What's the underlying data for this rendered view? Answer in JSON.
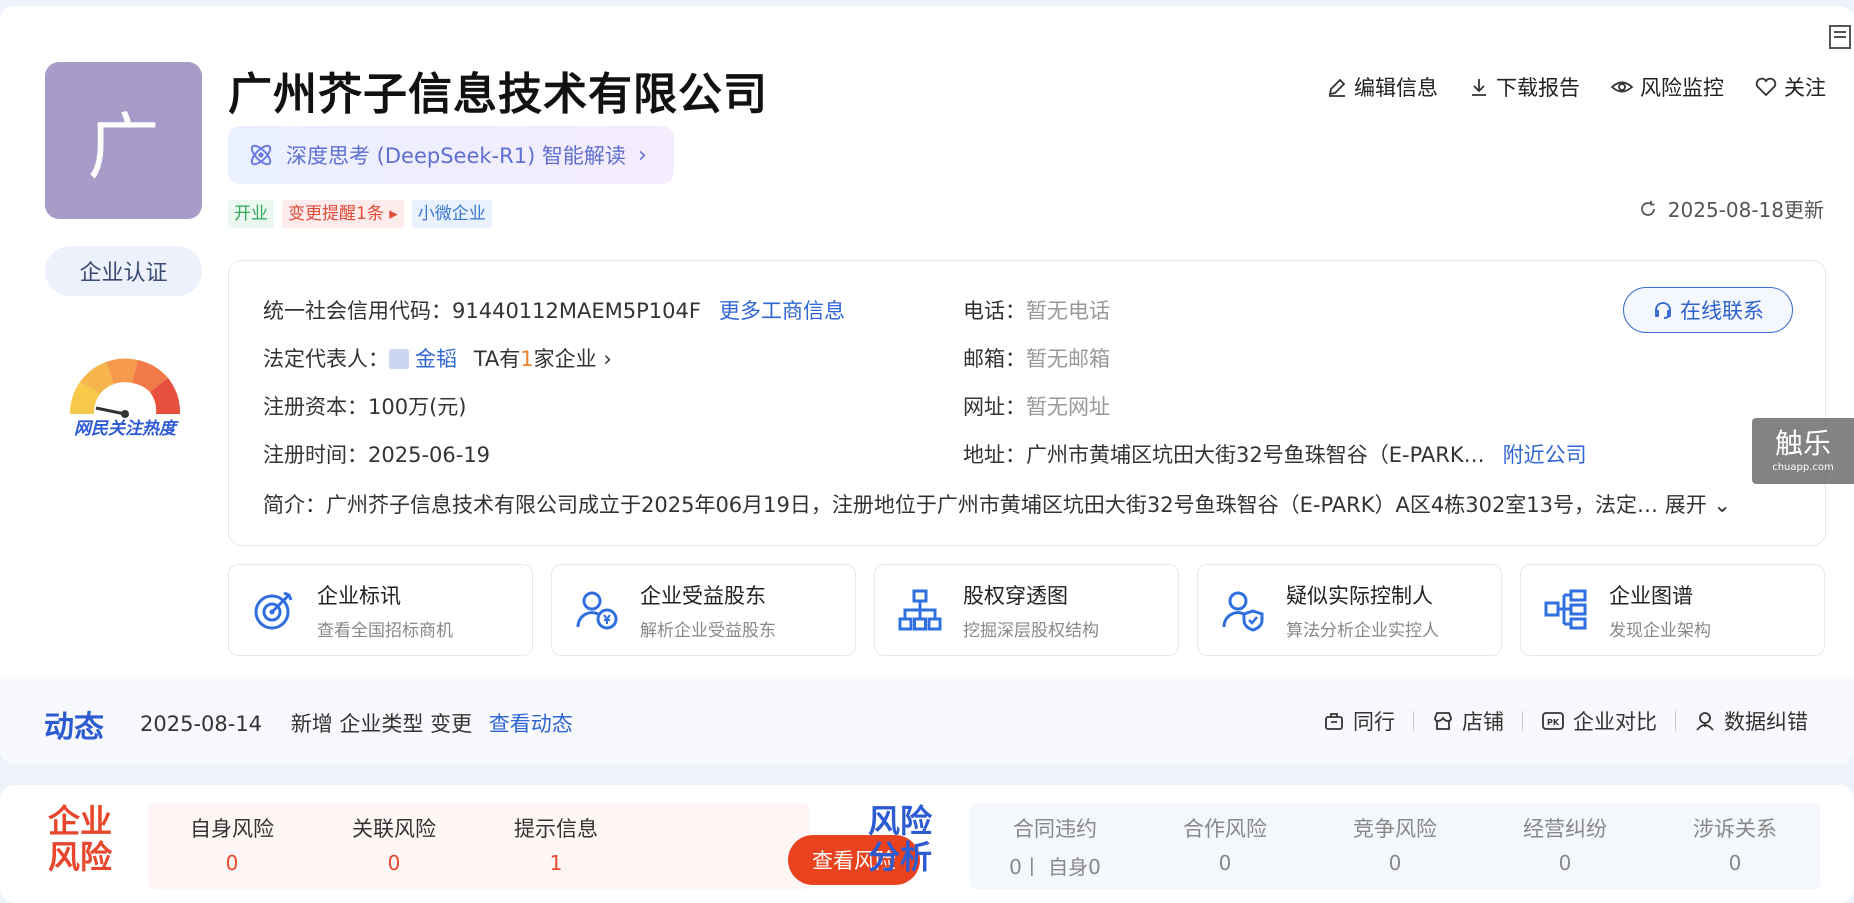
{
  "company": {
    "avatar_char": "广",
    "name": "广州芥子信息技术有限公司",
    "cert_label": "企业认证",
    "heat_label": "网民关注热度"
  },
  "deepseek": {
    "label": "深度思考 (DeepSeek-R1) 智能解读",
    "arrow": "›"
  },
  "tags": {
    "status": "开业",
    "change": "变更提醒1条",
    "change_arrow": "▸",
    "size": "小微企业"
  },
  "top_actions": {
    "edit": "编辑信息",
    "download": "下载报告",
    "monitor": "风险监控",
    "follow": "关注"
  },
  "updated": "2025-08-18更新",
  "info": {
    "credit_label": "统一社会信用代码：",
    "credit_value": "91440112MAEM5P104F",
    "more_link": "更多工商信息",
    "legal_label": "法定代表人：",
    "legal_name": "金韬",
    "legal_extra_pre": "TA有",
    "legal_extra_num": "1",
    "legal_extra_post": "家企业",
    "legal_arrow": "›",
    "capital_label": "注册资本：",
    "capital_value": "100万(元)",
    "date_label": "注册时间：",
    "date_value": "2025-06-19",
    "phone_label": "电话：",
    "phone_value": "暂无电话",
    "email_label": "邮箱：",
    "email_value": "暂无邮箱",
    "website_label": "网址：",
    "website_value": "暂无网址",
    "address_label": "地址：",
    "address_value": "广州市黄埔区坑田大街32号鱼珠智谷（E-PARK…",
    "nearby_link": "附近公司",
    "intro_label": "简介：",
    "intro_value": "广州芥子信息技术有限公司成立于2025年06月19日，注册地位于广州市黄埔区坑田大街32号鱼珠智谷（E-PARK）A区4栋302室13号，法定…",
    "expand": "展开",
    "online_contact": "在线联系"
  },
  "features": [
    {
      "title": "企业标讯",
      "sub": "查看全国招标商机"
    },
    {
      "title": "企业受益股东",
      "sub": "解析企业受益股东"
    },
    {
      "title": "股权穿透图",
      "sub": "挖掘深层股权结构"
    },
    {
      "title": "疑似实际控制人",
      "sub": "算法分析企业实控人"
    },
    {
      "title": "企业图谱",
      "sub": "发现企业架构"
    }
  ],
  "dynamics": {
    "title": "动态",
    "date": "2025-08-14",
    "text": "新增 企业类型 变更",
    "link": "查看动态",
    "actions": {
      "peer": "同行",
      "shop": "店铺",
      "compare": "企业对比",
      "correct": "数据纠错"
    }
  },
  "risk": {
    "title_line1": "企业",
    "title_line2": "风险",
    "self_label": "自身风险",
    "self_value": "0",
    "related_label": "关联风险",
    "related_value": "0",
    "hint_label": "提示信息",
    "hint_value": "1",
    "button": "查看风险"
  },
  "analysis": {
    "title_line1": "风险",
    "title_line2": "分析",
    "contract_label": "合同违约",
    "contract_value": "0丨 自身0",
    "coop_label": "合作风险",
    "coop_value": "0",
    "compete_label": "竞争风险",
    "compete_value": "0",
    "dispute_label": "经营纠纷",
    "dispute_value": "0",
    "litigation_label": "涉诉关系",
    "litigation_value": "0"
  },
  "watermark": {
    "big": "触乐",
    "small": "chuapp.com"
  },
  "colors": {
    "accent_blue": "#2d5bd1",
    "accent_red": "#e8462d",
    "avatar_bg": "#a99bc8"
  }
}
